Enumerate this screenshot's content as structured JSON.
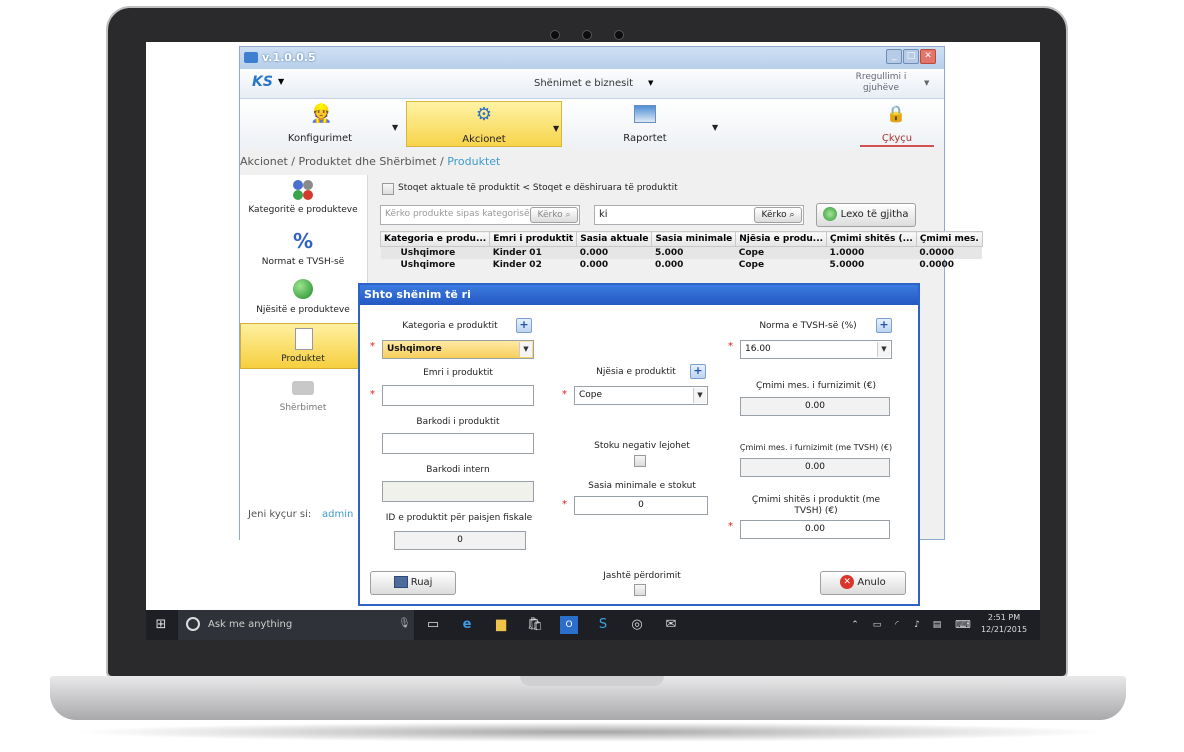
{
  "app": {
    "version": "v.1.0.0.5",
    "business_menu": "Shënimet e biznesit",
    "language_label": "Rregullimi i gjuhëve",
    "logo_text": "KS"
  },
  "ribbon": {
    "items": [
      {
        "label": "Konfigurimet"
      },
      {
        "label": "Akcionet"
      },
      {
        "label": "Raportet"
      },
      {
        "label": "Çkyçu"
      }
    ]
  },
  "breadcrumb": {
    "part1": "Akcionet",
    "sep": "/",
    "part2": "Produktet dhe Shërbimet",
    "current": "Produktet"
  },
  "sidebar": {
    "items": [
      {
        "label": "Kategoritë e produkteve"
      },
      {
        "label": "Normat e TVSH-së"
      },
      {
        "label": "Njësitë e produkteve"
      },
      {
        "label": "Produktet"
      },
      {
        "label": "Shërbimet"
      }
    ],
    "logged_in_label": "Jeni kyçur si:",
    "logged_in_user": "admin"
  },
  "filters": {
    "stock_checkbox_label": "Stoqet aktuale të produktit < Stoqet e dëshiruara të produktit",
    "category_search_placeholder": "Kërko produkte sipas kategorisë",
    "category_search_button": "Kërko",
    "search_value": "ki",
    "search_button": "Kërko",
    "read_all_button": "Lexo të gjitha"
  },
  "table": {
    "headers": [
      "Kategoria e produ...",
      "Emri i produktit",
      "Sasia aktuale",
      "Sasia minimale",
      "Njësia e produ...",
      "Çmimi shitës (...",
      "Çmimi mes."
    ],
    "rows": [
      [
        "Ushqimore",
        "Kinder 01",
        "0.000",
        "5.000",
        "Cope",
        "1.0000",
        "0.0000"
      ],
      [
        "Ushqimore",
        "Kinder 02",
        "0.000",
        "0.000",
        "Cope",
        "5.0000",
        "0.0000"
      ]
    ]
  },
  "dialog": {
    "title": "Shto shënim të ri",
    "category_label": "Kategoria e produktit",
    "category_value": "Ushqimore",
    "vat_label": "Norma e TVSH-së (%)",
    "vat_value": "16.00",
    "name_label": "Emri i produktit",
    "name_value": "",
    "unit_label": "Njësia e produktit",
    "unit_value": "Cope",
    "avg_price_label": "Çmimi mes. i furnizimit (€)",
    "avg_price_value": "0.00",
    "barcode_label": "Barkodi i produktit",
    "barcode_value": "",
    "negative_stock_label": "Stoku negativ lejohet",
    "avg_price_vat_label": "Çmimi mes. i furnizimit (me TVSH) (€)",
    "avg_price_vat_value": "0.00",
    "internal_barcode_label": "Barkodi intern",
    "min_stock_label": "Sasia minimale e stokut",
    "min_stock_value": "0",
    "sale_price_label": "Çmimi shitës i produktit (me TVSH) (€)",
    "sale_price_value": "0.00",
    "fiscal_id_label": "ID e produktit për paisjen fiskale",
    "fiscal_id_value": "0",
    "save_button": "Ruaj",
    "out_of_use_label": "Jashtë përdorimit",
    "cancel_button": "Anulo",
    "required_mark": "*",
    "plus": "+"
  },
  "taskbar": {
    "search_placeholder": "Ask me anything",
    "time": "2:51 PM",
    "date": "12/21/2015"
  }
}
